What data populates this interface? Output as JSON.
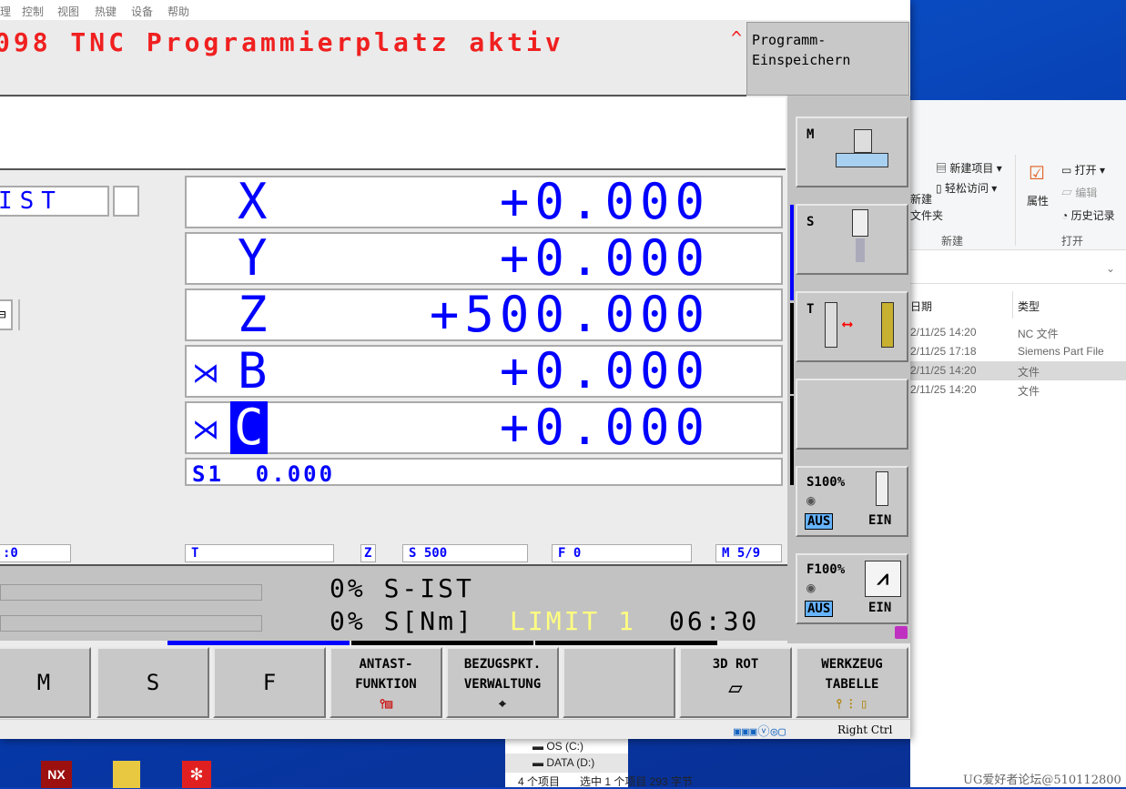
{
  "vm_menu": [
    "理",
    "控制",
    "视图",
    "热键",
    "设备",
    "帮助"
  ],
  "header": {
    "message": "098 TNC Programmierplatz aktiv",
    "softkey_line1": "Programm-",
    "softkey_line2": "Einspeichern"
  },
  "mode_field": "IST",
  "axes": [
    {
      "name": "X",
      "value": "+0.000",
      "clamped": false,
      "highlighted": false
    },
    {
      "name": "Y",
      "value": "+0.000",
      "clamped": false,
      "highlighted": false
    },
    {
      "name": "Z",
      "value": "+500.000",
      "clamped": false,
      "highlighted": false
    },
    {
      "name": "B",
      "value": "+0.000",
      "clamped": true,
      "highlighted": false
    },
    {
      "name": "C",
      "value": "+0.000",
      "clamped": true,
      "highlighted": true
    }
  ],
  "spindle_line": "S1  0.000",
  "status_fields": {
    "left": ":0",
    "t": "T",
    "z": "Z",
    "s": "S 500",
    "f": "F 0",
    "m": "M 5/9"
  },
  "load_panel": {
    "s_ist": "0% S-IST",
    "s_nm": "0% S[Nm]",
    "limit": "LIMIT 1",
    "time": "06:30"
  },
  "vertical_softkeys": {
    "m": "M",
    "s": "S",
    "t": "T",
    "s_override": "S100%",
    "f_override": "F100%",
    "aus": "AUS",
    "ein": "EIN"
  },
  "bottom_softkeys": [
    {
      "line1": "M",
      "line2": ""
    },
    {
      "line1": "S",
      "line2": ""
    },
    {
      "line1": "F",
      "line2": ""
    },
    {
      "line1": "ANTAST-",
      "line2": "FUNKTION"
    },
    {
      "line1": "BEZUGSPKT.",
      "line2": "VERWALTUNG"
    },
    {
      "line1": "",
      "line2": ""
    },
    {
      "line1": "3D ROT",
      "line2": ""
    },
    {
      "line1": "WERKZEUG",
      "line2": "TABELLE"
    }
  ],
  "vm_status": {
    "host_key": "Right Ctrl"
  },
  "explorer": {
    "new_item": "新建项目",
    "easy_access": "轻松访问",
    "new_folder_1": "新建",
    "new_folder_2": "文件夹",
    "group_new": "新建",
    "properties": "属性",
    "open": "打开",
    "edit": "编辑",
    "history": "历史记录",
    "group_open": "打开",
    "col_date": "日期",
    "col_type": "类型",
    "rows": [
      {
        "date": "2/11/25 14:20",
        "type": "NC 文件"
      },
      {
        "date": "2/11/25 17:18",
        "type": "Siemens Part File"
      },
      {
        "date": "2/11/25 14:20",
        "type": "文件"
      },
      {
        "date": "2/11/25 14:20",
        "type": "文件"
      }
    ],
    "drive_c": "OS (C:)",
    "drive_d": "DATA (D:)",
    "status": "4 个项目",
    "selected": "选中 1 个项目  293 字节"
  },
  "watermark": "UG爱好者论坛@510112800",
  "colors": {
    "axis_blue": "#0000ff",
    "alert_red": "#f02020",
    "limit_yellow": "#ffff80",
    "aus_bg": "#66b3ff"
  }
}
